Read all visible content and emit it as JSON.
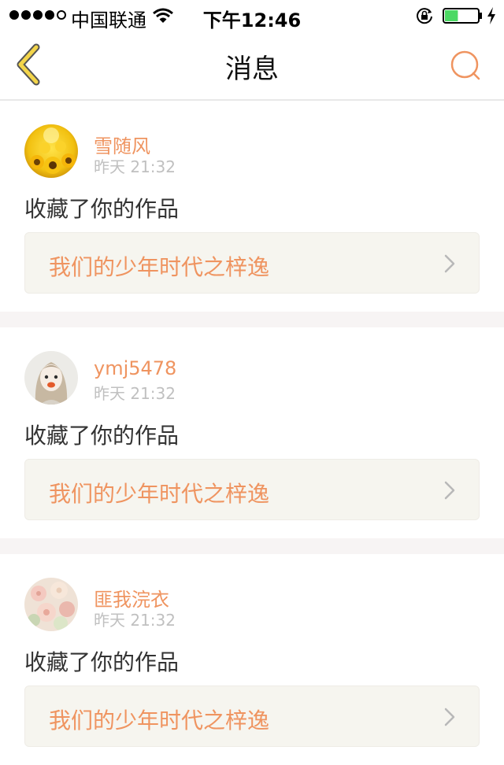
{
  "status_bar": {
    "carrier": "中国联通",
    "time": "下午12:46",
    "battery_level_fraction": 0.4
  },
  "nav": {
    "title": "消息",
    "back_icon": "chevron-left-icon",
    "search_icon": "search-icon"
  },
  "messages": [
    {
      "username": "雪随风",
      "time": "昨天 21:32",
      "action": "收藏了你的作品",
      "work_title": "我们的少年时代之梓逸",
      "avatar": "sunflower-avatar"
    },
    {
      "username": "ymj5478",
      "time": "昨天 21:32",
      "action": "收藏了你的作品",
      "work_title": "我们的少年时代之梓逸",
      "avatar": "anime-girl-avatar"
    },
    {
      "username": "匪我浣衣",
      "time": "昨天 21:32",
      "action": "收藏了你的作品",
      "work_title": "我们的少年时代之梓逸",
      "avatar": "flowers-avatar"
    }
  ],
  "colors": {
    "accent": "#ef9460",
    "back_icon": "#f3d54a",
    "link_background": "#f6f5ef",
    "timestamp": "#c0c0c0",
    "separator": "#f7f4f4"
  }
}
